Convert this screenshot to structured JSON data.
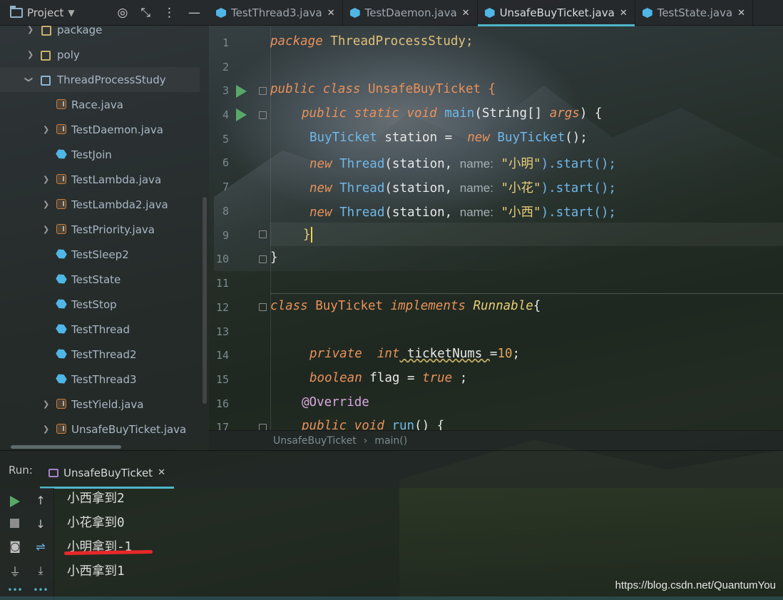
{
  "project_panel": {
    "title": "Project",
    "items": [
      {
        "label": "package",
        "type": "package",
        "expanded": false
      },
      {
        "label": "poly",
        "type": "package",
        "expanded": false
      },
      {
        "label": "ThreadProcessStudy",
        "type": "folder",
        "expanded": true
      },
      {
        "label": "Race.java",
        "type": "java-file"
      },
      {
        "label": "TestDaemon.java",
        "type": "java-file",
        "expandable": true
      },
      {
        "label": "TestJoin",
        "type": "class"
      },
      {
        "label": "TestLambda.java",
        "type": "java-file",
        "expandable": true
      },
      {
        "label": "TestLambda2.java",
        "type": "java-file",
        "expandable": true
      },
      {
        "label": "TestPriority.java",
        "type": "java-file",
        "expandable": true
      },
      {
        "label": "TestSleep2",
        "type": "class"
      },
      {
        "label": "TestState",
        "type": "class"
      },
      {
        "label": "TestStop",
        "type": "class"
      },
      {
        "label": "TestThread",
        "type": "class"
      },
      {
        "label": "TestThread2",
        "type": "class"
      },
      {
        "label": "TestThread3",
        "type": "class"
      },
      {
        "label": "TestYield.java",
        "type": "java-file",
        "expandable": true
      },
      {
        "label": "UnsafeBuyTicket.java",
        "type": "java-file",
        "expandable": true
      }
    ]
  },
  "editor_tabs": [
    {
      "label": "TestThread3.java",
      "active": false
    },
    {
      "label": "TestDaemon.java",
      "active": false
    },
    {
      "label": "UnsafeBuyTicket.java",
      "active": true
    },
    {
      "label": "TestState.java",
      "active": false
    }
  ],
  "editor": {
    "line_numbers": [
      "1",
      "2",
      "3",
      "4",
      "5",
      "6",
      "7",
      "8",
      "9",
      "10",
      "11",
      "12",
      "13",
      "14",
      "15",
      "16",
      "17"
    ],
    "code": {
      "l1_kw": "package",
      "l1_rest": " ThreadProcessStudy;",
      "l3_kw": "public class",
      "l3_rest": " UnsafeBuyTicket {",
      "l4_kw": "public static void",
      "l4_fn": " main",
      "l4_rest": "(String[] ",
      "l4_args": "args",
      "l4_end": ") {",
      "l5_type": "BuyTicket",
      "l5_mid": " station =  ",
      "l5_kw": "new",
      "l5_type2": " BuyTicket",
      "l5_end": "();",
      "l6_kw": "new",
      "l6_type": " Thread",
      "l6_mid": "(station, ",
      "l6_hint": "name:",
      "l6_str": " \"小明\"",
      "l6_end": ").start();",
      "l7_kw": "new",
      "l7_type": " Thread",
      "l7_mid": "(station, ",
      "l7_hint": "name:",
      "l7_str": " \"小花\"",
      "l7_end": ").start();",
      "l8_kw": "new",
      "l8_type": " Thread",
      "l8_mid": "(station, ",
      "l8_hint": "name:",
      "l8_str": " \"小西\"",
      "l8_end": ").start();",
      "l9": "}",
      "l10": "}",
      "l12_kw": "class",
      "l12_mid": " BuyTicket ",
      "l12_kw2": "implements",
      "l12_iface": " Runnable",
      "l12_end": "{",
      "l14_kw": "private",
      "l14_kw2": "  int",
      "l14_mid": " ticketNums ",
      "l14_eq": "=",
      "l14_num": "10",
      "l14_end": ";",
      "l15_kw": "boolean",
      "l15_mid": " flag = ",
      "l15_kw2": "true",
      "l15_end": " ;",
      "l16": "@Override",
      "l17_kw": "public void",
      "l17_fn": " run",
      "l17_end": "() {"
    }
  },
  "breadcrumb": {
    "class": "UnsafeBuyTicket",
    "method": "main()"
  },
  "run_panel": {
    "label": "Run:",
    "tab": "UnsafeBuyTicket",
    "output": [
      "小西拿到2",
      "小花拿到0",
      "小明拿到-1",
      "小西拿到1"
    ]
  },
  "watermark": "https://blog.csdn.net/QuantumYou",
  "colors": {
    "accent": "#4fb6c9",
    "keyword": "#e8915b",
    "string": "#e7cd78",
    "highlight_underline": "#e8282a"
  }
}
